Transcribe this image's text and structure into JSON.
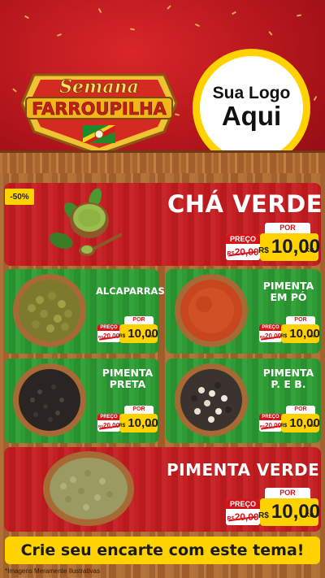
{
  "header": {
    "title_line1": "Semana",
    "title_line2": "FARROUPILHA",
    "logo_line1": "Sua Logo",
    "logo_line2": "Aqui"
  },
  "featured_top": {
    "badge": "-50%",
    "name": "CHÁ VERDE",
    "preco_label": "PREÇO",
    "old_currency": "R$",
    "old_price": "20,00",
    "por_label": "POR",
    "currency": "R$",
    "price": "10,00",
    "unit": "KG"
  },
  "products": [
    {
      "name_line1": "ALCAPARRAS",
      "name_line2": "",
      "preco_label": "PREÇO",
      "old_currency": "R$",
      "old_price": "20,00",
      "por_label": "POR",
      "currency": "R$",
      "price": "10,00",
      "unit": "KG"
    },
    {
      "name_line1": "PIMENTA",
      "name_line2": "EM PÓ",
      "preco_label": "PREÇO",
      "old_currency": "R$",
      "old_price": "20,00",
      "por_label": "POR",
      "currency": "R$",
      "price": "10,00",
      "unit": "KG"
    },
    {
      "name_line1": "PIMENTA",
      "name_line2": "PRETA",
      "preco_label": "PREÇO",
      "old_currency": "R$",
      "old_price": "20,00",
      "por_label": "POR",
      "currency": "R$",
      "price": "10,00",
      "unit": "KG"
    },
    {
      "name_line1": "PIMENTA",
      "name_line2": "P. E B.",
      "preco_label": "PREÇO",
      "old_currency": "R$",
      "old_price": "20,00",
      "por_label": "POR",
      "currency": "R$",
      "price": "10,00",
      "unit": "KG"
    }
  ],
  "featured_bottom": {
    "name": "PIMENTA VERDE",
    "preco_label": "PREÇO",
    "old_currency": "R$",
    "old_price": "20,00",
    "por_label": "POR",
    "currency": "R$",
    "price": "10,00",
    "unit": "KG"
  },
  "banner": {
    "text": "Crie seu encarte com este tema!"
  },
  "footnote": "*Imagens Meramente Ilustrativas",
  "colors": {
    "red": "#c41f22",
    "green": "#2f9b35",
    "yellow": "#ffd200",
    "wood": "#a9652e"
  }
}
